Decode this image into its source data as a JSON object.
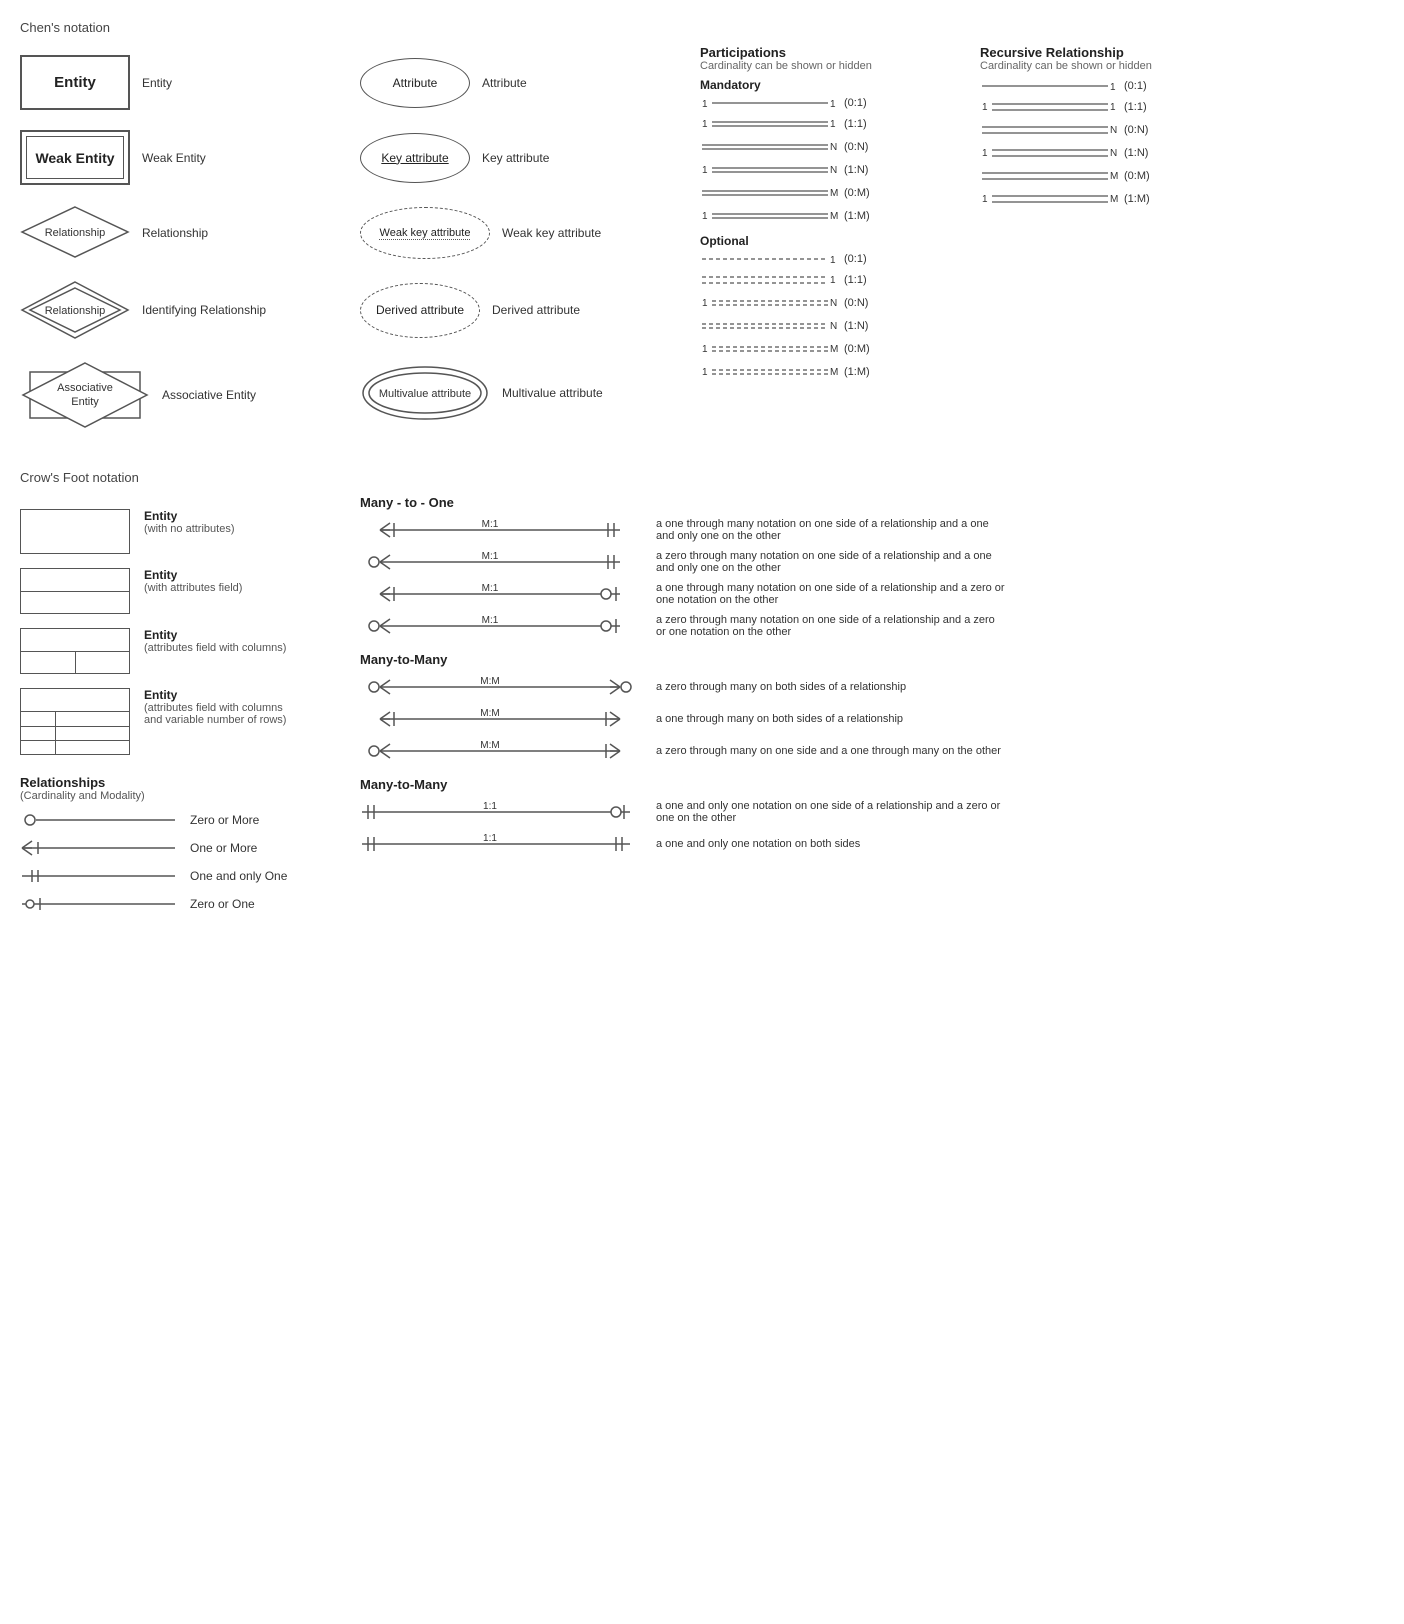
{
  "chens": {
    "title": "Chen's notation",
    "entities": [
      {
        "shape": "entity",
        "label": "Entity",
        "name": "Entity"
      },
      {
        "shape": "weak-entity",
        "label": "Weak Entity",
        "name": "Weak Entity"
      },
      {
        "shape": "relationship",
        "label": "Relationship",
        "name": "Relationship"
      },
      {
        "shape": "identifying-relationship",
        "label": "Identifying Relationship",
        "name": "Relationship"
      },
      {
        "shape": "associative-entity",
        "label": "Associative Entity",
        "name": "Associative\nEntity"
      }
    ],
    "attributes": [
      {
        "shape": "attribute",
        "label": "Attribute",
        "name": "Attribute"
      },
      {
        "shape": "key-attribute",
        "label": "Key attribute",
        "name": "Key attribute"
      },
      {
        "shape": "weak-key-attribute",
        "label": "Weak key attribute",
        "name": "Weak key attribute"
      },
      {
        "shape": "derived-attribute",
        "label": "Derived attribute",
        "name": "Derived attribute"
      },
      {
        "shape": "multivalue-attribute",
        "label": "Multivalue attribute",
        "name": "Multivalue attribute"
      }
    ]
  },
  "participations": {
    "title": "Participations",
    "subtitle": "Cardinality can be shown or hidden",
    "mandatory_label": "Mandatory",
    "optional_label": "Optional",
    "mandatory_rows": [
      {
        "left": "1",
        "right": "1",
        "notation": "(0:1)"
      },
      {
        "left": "1",
        "right": "1",
        "notation": "(1:1)"
      },
      {
        "left": "",
        "right": "N",
        "notation": "(0:N)"
      },
      {
        "left": "1",
        "right": "N",
        "notation": "(1:N)"
      },
      {
        "left": "",
        "right": "M",
        "notation": "(0:M)"
      },
      {
        "left": "1",
        "right": "M",
        "notation": "(1:M)"
      }
    ],
    "optional_rows": [
      {
        "left": "",
        "right": "1",
        "notation": "(0:1)"
      },
      {
        "left": "",
        "right": "1",
        "notation": "(1:1)"
      },
      {
        "left": "1",
        "right": "N",
        "notation": "(0:N)"
      },
      {
        "left": "",
        "right": "N",
        "notation": "(1:N)"
      },
      {
        "left": "1",
        "right": "M",
        "notation": "(0:M)"
      },
      {
        "left": "1",
        "right": "M",
        "notation": "(1:M)"
      }
    ]
  },
  "recursive": {
    "title": "Recursive Relationship",
    "subtitle": "Cardinality can be shown or hidden",
    "rows": [
      {
        "left": "",
        "right": "1",
        "notation": "(0:1)"
      },
      {
        "left": "1",
        "right": "1",
        "notation": "(1:1)"
      },
      {
        "left": "",
        "right": "N",
        "notation": "(0:N)"
      },
      {
        "left": "1",
        "right": "N",
        "notation": "(1:N)"
      },
      {
        "left": "",
        "right": "M",
        "notation": "(0:M)"
      },
      {
        "left": "1",
        "right": "M",
        "notation": "(1:M)"
      }
    ]
  },
  "crows": {
    "title": "Crow's Foot notation",
    "entities": [
      {
        "type": "simple",
        "label": "Entity",
        "sublabel": "(with no attributes)"
      },
      {
        "type": "attr",
        "label": "Entity",
        "sublabel": "(with attributes field)"
      },
      {
        "type": "cols",
        "label": "Entity",
        "sublabel": "(attributes field with columns)"
      },
      {
        "type": "rows",
        "label": "Entity",
        "sublabel": "(attributes field with columns and\nvariable number of rows)"
      }
    ],
    "relationships_label": "Relationships",
    "relationships_sublabel": "(Cardinality and Modality)",
    "rel_rows": [
      {
        "symbol": "zero-or-more",
        "label": "Zero or More"
      },
      {
        "symbol": "one-or-more",
        "label": "One or More"
      },
      {
        "symbol": "one-and-only-one",
        "label": "One and only One"
      },
      {
        "symbol": "zero-or-one",
        "label": "Zero or One"
      }
    ],
    "many_to_one_title": "Many - to - One",
    "many_to_one_rows": [
      {
        "label": "M:1",
        "desc": "a one through many notation on one side of a relationship\nand a one and only one on the other"
      },
      {
        "label": "M:1",
        "desc": "a zero through many notation on one side of a relationship\nand a one and only one on the other"
      },
      {
        "label": "M:1",
        "desc": "a one through many notation on one side of a relationship\nand a zero or one notation on the other"
      },
      {
        "label": "M:1",
        "desc": "a zero through many notation on one side of a relationship\nand a zero or one notation on the other"
      }
    ],
    "many_to_many_title": "Many-to-Many",
    "many_to_many_rows": [
      {
        "label": "M:M",
        "desc": "a zero through many on both sides of a relationship"
      },
      {
        "label": "M:M",
        "desc": "a one through many on both sides of a relationship"
      },
      {
        "label": "M:M",
        "desc": "a zero through many on one side and a one through many\non the other"
      }
    ],
    "many_to_many2_title": "Many-to-Many",
    "one_to_one_rows": [
      {
        "label": "1:1",
        "desc": "a one and only one notation on one side of a relationship\nand a zero or one on the other"
      },
      {
        "label": "1:1",
        "desc": "a one and only one notation on both sides"
      }
    ]
  }
}
